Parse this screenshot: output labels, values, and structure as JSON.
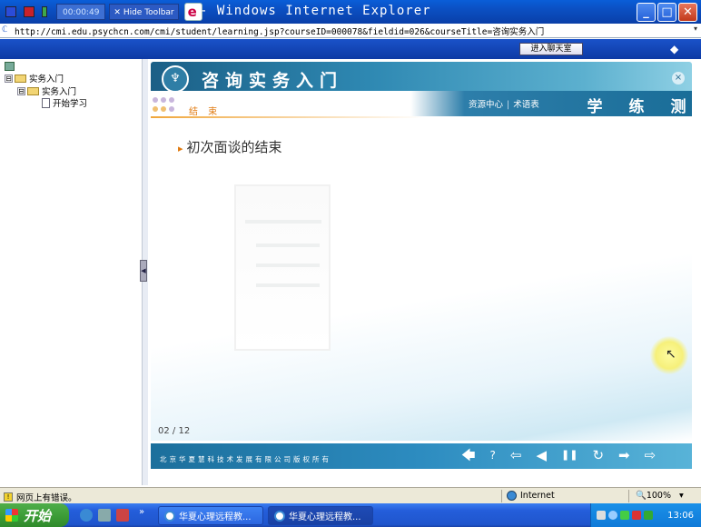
{
  "recorder": {
    "timer": "00:00:49",
    "hide_toolbar": "Hide Toolbar",
    "button_colors": [
      "#2b4cd8",
      "#c8222a",
      "#3fa84a"
    ]
  },
  "window": {
    "title": "- Windows Internet Explorer",
    "minimize": "_",
    "maximize": "□",
    "close": "✕"
  },
  "address": {
    "url": "http://cmi.edu.psychcn.com/cmi/student/learning.jsp?courseID=000078&fieldid=026&courseTitle=咨询实务入门",
    "dropdown": "▾"
  },
  "toolbar": {
    "chat_button": "进入聊天室"
  },
  "tree": {
    "items": [
      {
        "label": "实务入门",
        "toggle": "⊟"
      },
      {
        "label": "实务入门",
        "toggle": "⊟"
      },
      {
        "label": "开始学习"
      }
    ]
  },
  "course": {
    "logo_glyph": "♆",
    "title": "咨询实务入门",
    "close": "×",
    "section": "结 束",
    "links": [
      "资源中心",
      "术语表"
    ],
    "study_buttons": [
      "学",
      "练",
      "测"
    ]
  },
  "slide": {
    "heading_marker": "▸",
    "heading": "初次面谈的结束",
    "page": "02 / 12"
  },
  "footer": {
    "copyright": "北京华夏慧科技术发展有限公司版权所有",
    "controls": [
      "🡄",
      "?",
      "⇦",
      "◀",
      "❚❚",
      "↻",
      "➡",
      "⇨"
    ]
  },
  "statusbar": {
    "message": "网页上有错误。",
    "zone": "Internet",
    "zoom": "🔍100%",
    "zoom_arrow": "▾"
  },
  "taskbar": {
    "start": "开始",
    "more": "»",
    "tasks": [
      "华夏心理远程教...",
      "华夏心理远程教..."
    ],
    "clock": "13:06"
  },
  "colors": {
    "accent_orange": "#e07a10",
    "header_teal": "#2e88b2",
    "xp_blue": "#245edb",
    "start_green": "#3a9a35"
  }
}
